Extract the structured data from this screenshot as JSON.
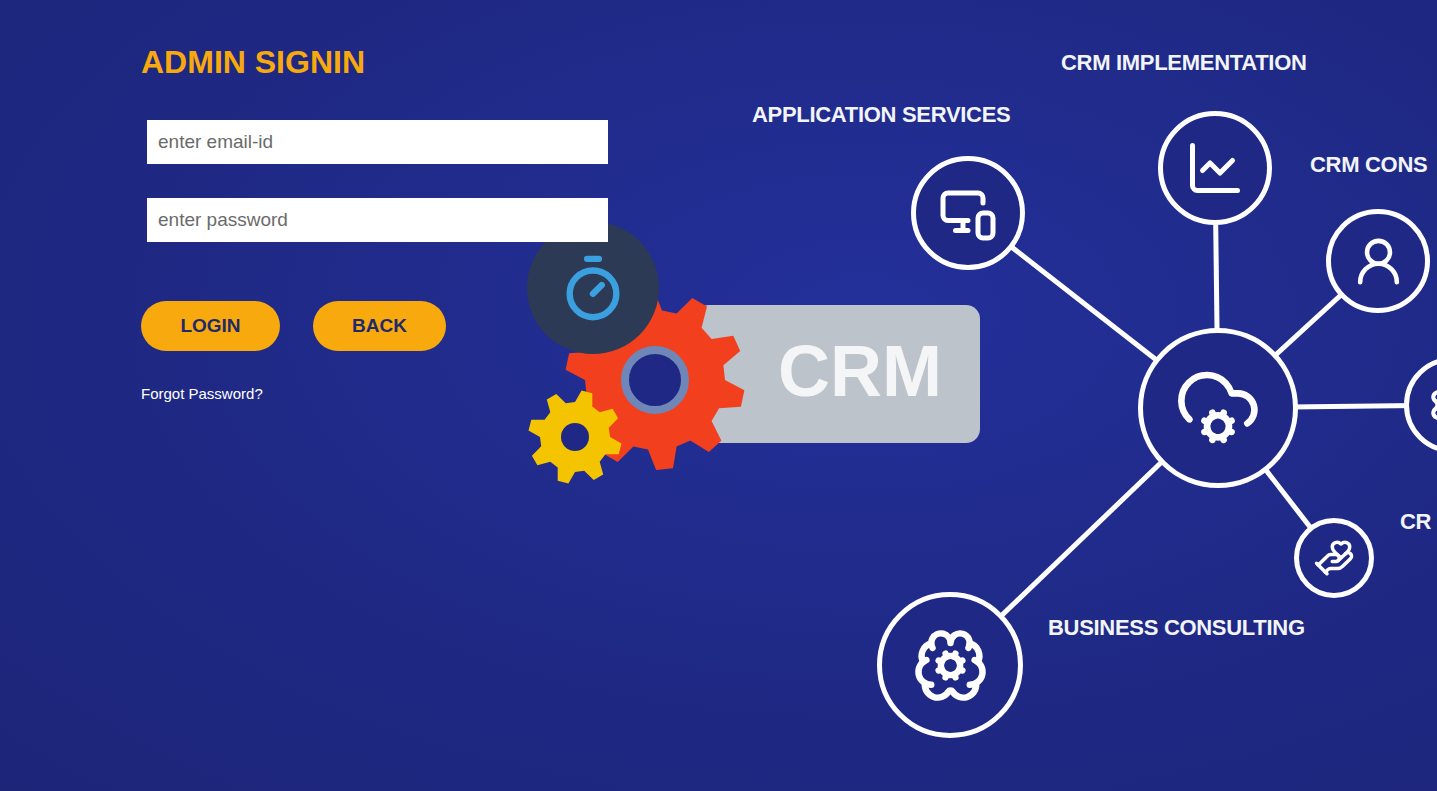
{
  "form": {
    "title": "ADMIN SIGNIN",
    "fields": [
      {
        "placeholder": "enter email-id",
        "kind": "email"
      },
      {
        "placeholder": "enter password",
        "kind": "password"
      }
    ],
    "buttons": [
      "LOGIN",
      "BACK"
    ],
    "forgot_link": "Forgot Password?"
  },
  "illustration": {
    "badge": "CRM",
    "labels": [
      "CRM IMPLEMENTATION",
      "APPLICATION SERVICES",
      "CRM CONS",
      "BUSINESS CONSULTING",
      "CR"
    ]
  }
}
